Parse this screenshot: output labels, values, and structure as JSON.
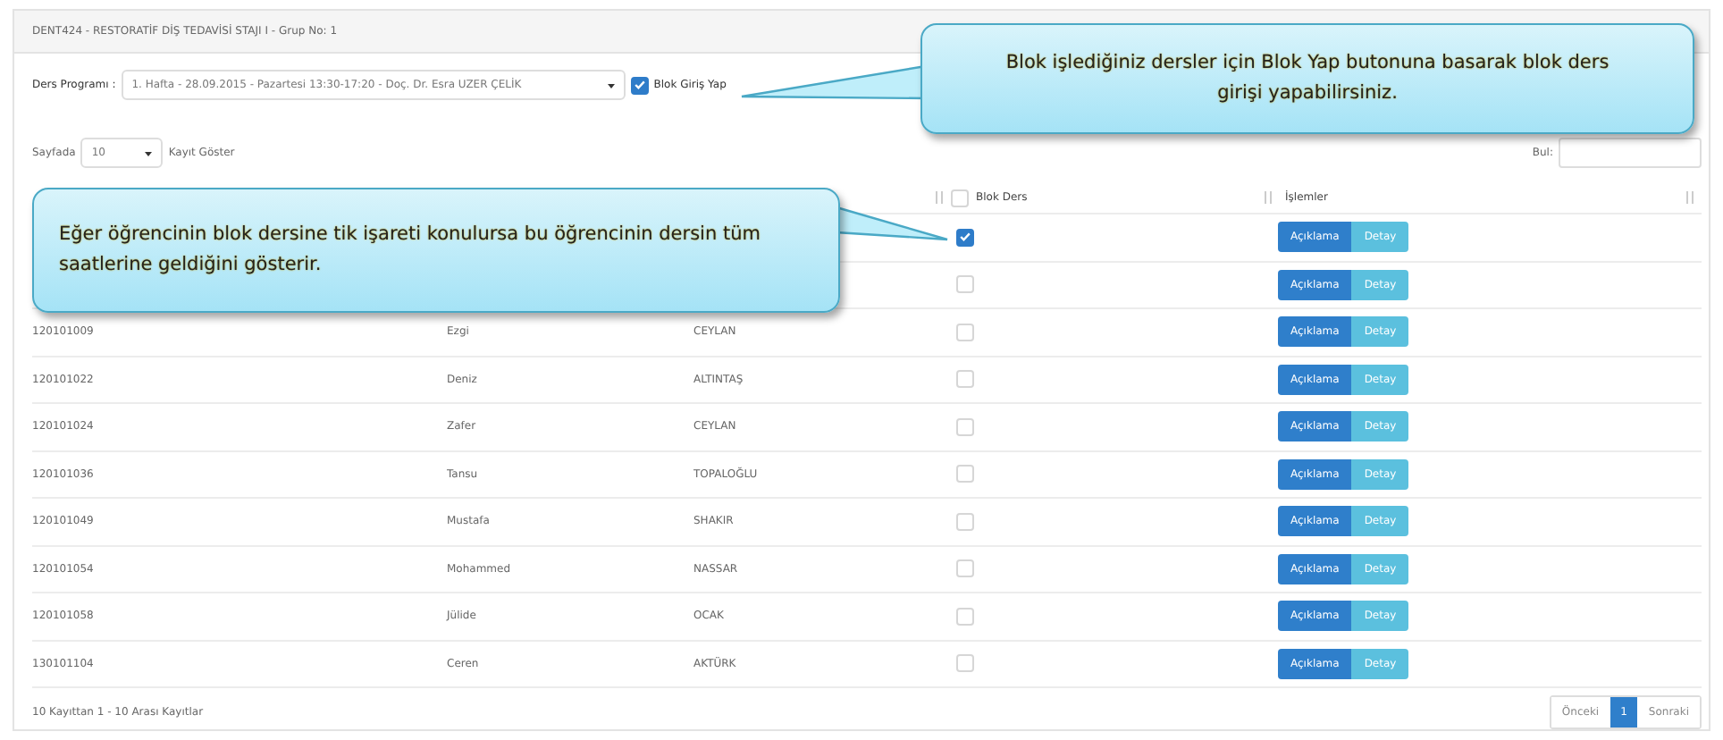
{
  "panel": {
    "title": "DENT424 - RESTORATİF DİŞ TEDAVİSİ STAJI I - Grup No: 1"
  },
  "program": {
    "label": "Ders Programı :",
    "value": "1. Hafta - 28.09.2015 - Pazartesi 13:30-17:20 - Doç. Dr. Esra UZER ÇELİK",
    "block_entry": {
      "label": "Blok Giriş Yap",
      "checked": true
    }
  },
  "page_size": {
    "prefix": "Sayfada",
    "value": "10",
    "suffix": "Kayıt Göster"
  },
  "search": {
    "label": "Bul:"
  },
  "table": {
    "columns": [
      {
        "label": "Blok Ders",
        "kind": "checkbox",
        "checked": false
      },
      {
        "label": "İşlemler",
        "kind": "text"
      }
    ],
    "rows": [
      {
        "checked": true,
        "actions": [
          "Açıklama",
          "Detay"
        ]
      },
      {
        "checked": false,
        "actions": [
          "Açıklama",
          "Detay"
        ]
      },
      {
        "id": "120101009",
        "first_name": "Ezgi",
        "last_name": "CEYLAN",
        "checked": false,
        "actions": [
          "Açıklama",
          "Detay"
        ]
      },
      {
        "id": "120101022",
        "first_name": "Deniz",
        "last_name": "ALTINTAŞ",
        "checked": false,
        "actions": [
          "Açıklama",
          "Detay"
        ]
      },
      {
        "id": "120101024",
        "first_name": "Zafer",
        "last_name": "CEYLAN",
        "checked": false,
        "actions": [
          "Açıklama",
          "Detay"
        ]
      },
      {
        "id": "120101036",
        "first_name": "Tansu",
        "last_name": "TOPALOĞLU",
        "checked": false,
        "actions": [
          "Açıklama",
          "Detay"
        ]
      },
      {
        "id": "120101049",
        "first_name": "Mustafa",
        "last_name": "SHAKIR",
        "checked": false,
        "actions": [
          "Açıklama",
          "Detay"
        ]
      },
      {
        "id": "120101054",
        "first_name": "Mohammed",
        "last_name": "NASSAR",
        "checked": false,
        "actions": [
          "Açıklama",
          "Detay"
        ]
      },
      {
        "id": "120101058",
        "first_name": "Jülide",
        "last_name": "OCAK",
        "checked": false,
        "actions": [
          "Açıklama",
          "Detay"
        ]
      },
      {
        "id": "130101104",
        "first_name": "Ceren",
        "last_name": "AKTÜRK",
        "checked": false,
        "actions": [
          "Açıklama",
          "Detay"
        ]
      }
    ]
  },
  "footer": {
    "info": "10 Kayıttan 1 - 10 Arası Kayıtlar",
    "pagination": [
      {
        "label": "Önceki",
        "selected": false
      },
      {
        "label": "1",
        "selected": true
      },
      {
        "label": "Sonraki",
        "selected": false
      }
    ]
  },
  "callouts": [
    {
      "text": "Blok işlediğiniz dersler için Blok Yap butonuna basarak blok ders girişi yapabilirsiniz.",
      "kind": "left"
    },
    {
      "text": "Eğer öğrencinin blok dersine tik işareti konulursa bu öğrencinin dersin tüm saatlerine geldiğini gösterir.",
      "kind": "right"
    }
  ]
}
